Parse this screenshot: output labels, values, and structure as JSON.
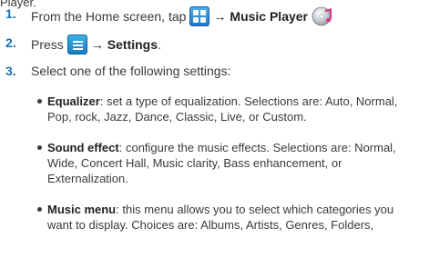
{
  "intro_tail": "Player.",
  "steps": [
    {
      "number": "1.",
      "prefix": "From the Home screen, tap",
      "icon_1": "apps-grid-icon",
      "arrow": "→",
      "target": "Music Player",
      "icon_2": "music-player-icon"
    },
    {
      "number": "2.",
      "prefix": "Press",
      "icon_1": "menu-key-icon",
      "arrow": "→",
      "target": "Settings",
      "suffix": "."
    },
    {
      "number": "3.",
      "text": "Select one of the following settings:"
    }
  ],
  "settings": [
    {
      "term": "Equalizer",
      "line_1": ": set a type of equalization. Selections are: Auto, Normal,",
      "line_2": "Pop, rock, Jazz, Dance, Classic, Live, or Custom."
    },
    {
      "term": "Sound effect",
      "line_1": ": configure the music effects. Selections are: Normal,",
      "line_2": "Wide, Concert Hall, Music clarity, Bass enhancement, or",
      "line_3": "Externalization."
    },
    {
      "term": "Music menu",
      "line_1": ": this menu allows you to select which categories you",
      "line_2": "want to display. Choices are: Albums, Artists, Genres, Folders,"
    }
  ],
  "colors": {
    "step_number": "#1a6fb5",
    "body_text": "#3a3a3a",
    "icon_blue": "#1c79c9"
  }
}
